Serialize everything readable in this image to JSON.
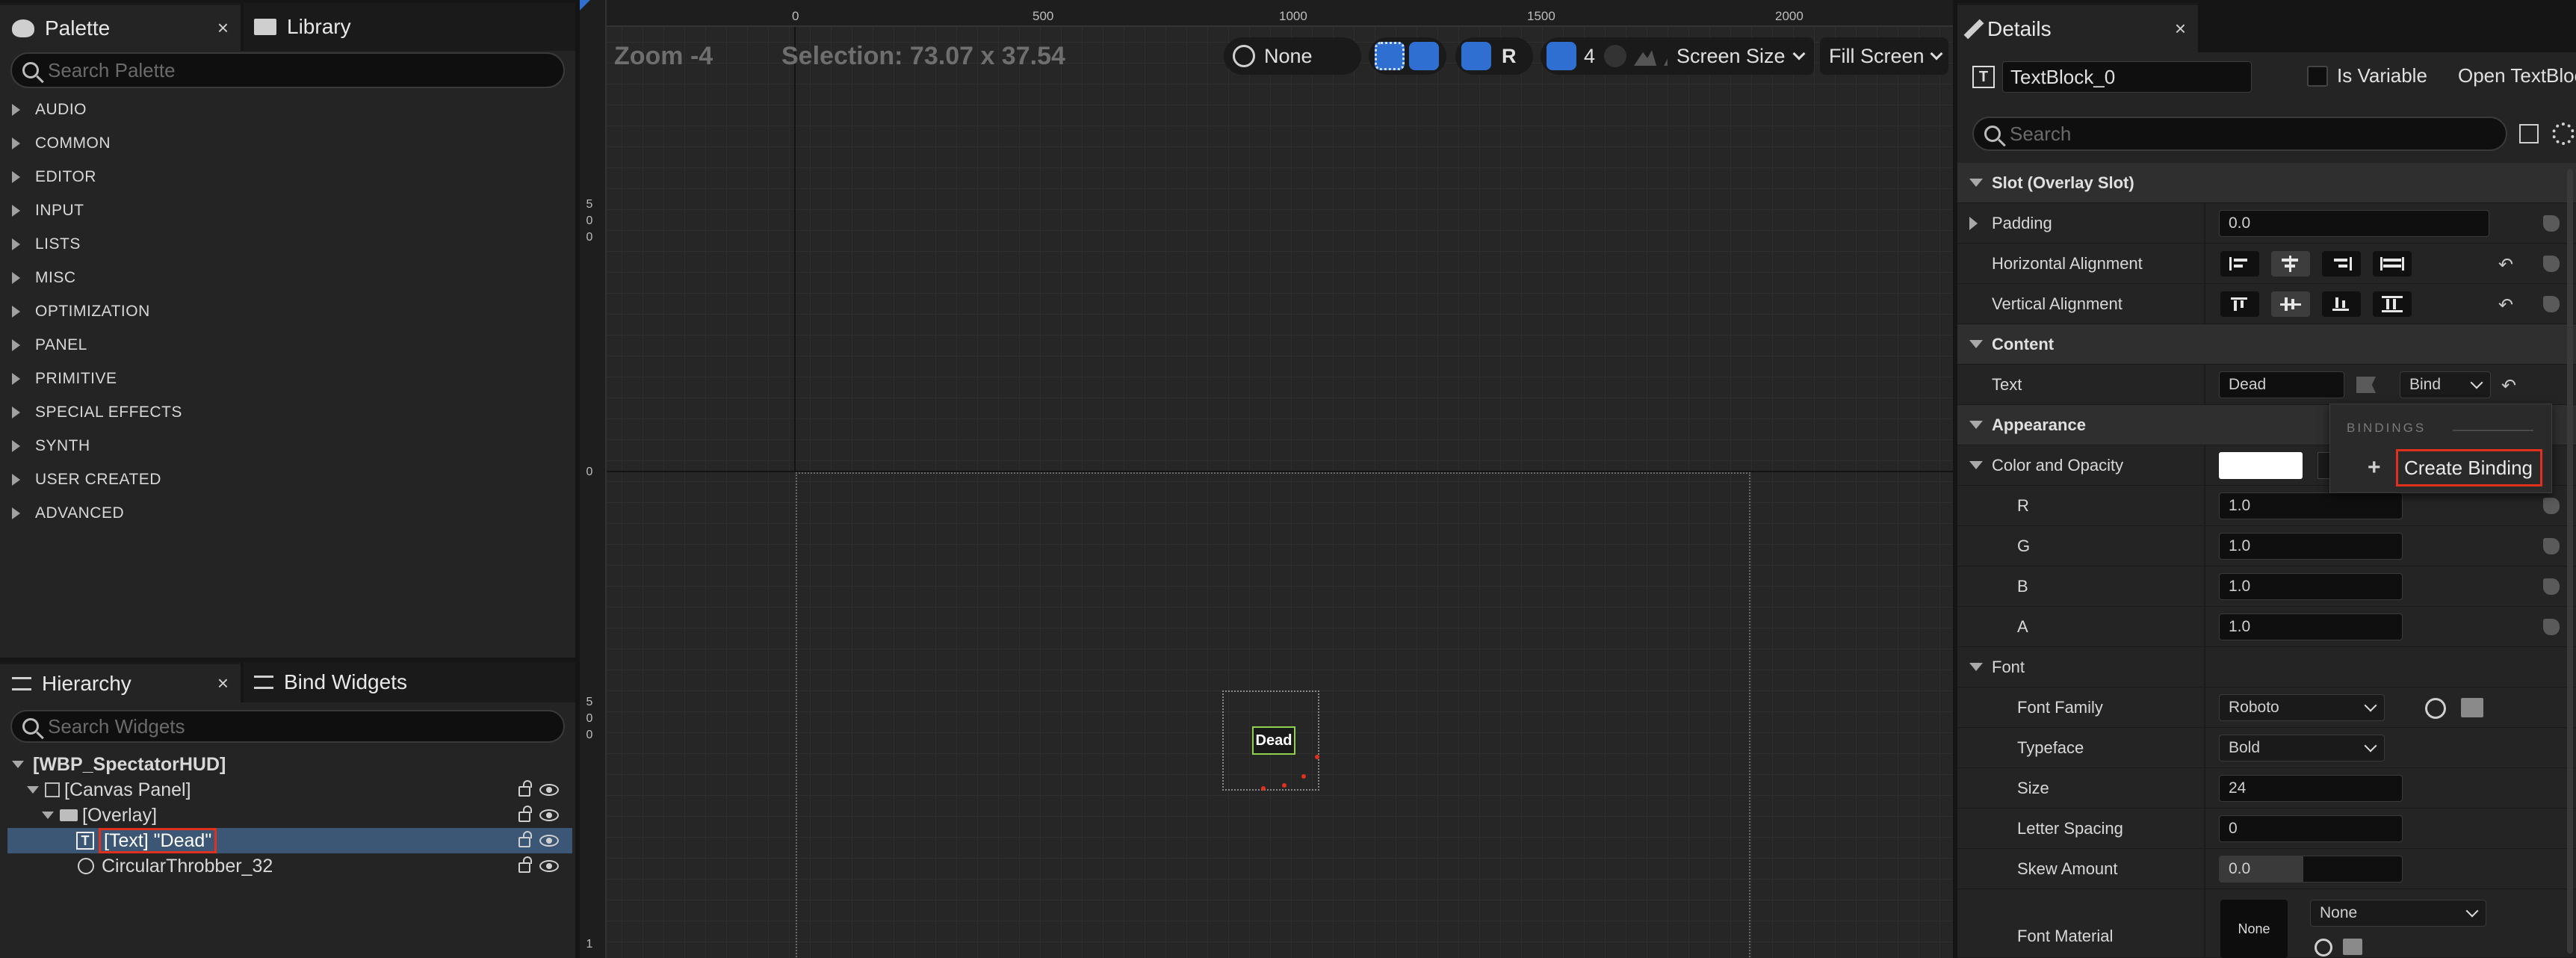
{
  "palette": {
    "tab_label": "Palette",
    "library_tab_label": "Library",
    "close_glyph": "×",
    "search_placeholder": "Search Palette",
    "categories": [
      "AUDIO",
      "COMMON",
      "EDITOR",
      "INPUT",
      "LISTS",
      "MISC",
      "OPTIMIZATION",
      "PANEL",
      "PRIMITIVE",
      "SPECIAL EFFECTS",
      "SYNTH",
      "USER CREATED",
      "ADVANCED"
    ]
  },
  "hierarchy": {
    "tab_label": "Hierarchy",
    "bind_widgets_tab_label": "Bind Widgets",
    "close_glyph": "×",
    "search_placeholder": "Search Widgets",
    "items": [
      {
        "label": "[WBP_SpectatorHUD]"
      },
      {
        "label": "[Canvas Panel]"
      },
      {
        "label": "[Overlay]"
      },
      {
        "label": "[Text] \"Dead\""
      },
      {
        "label": "CircularThrobber_32"
      }
    ]
  },
  "viewport": {
    "zoom": "Zoom -4",
    "selection": "Selection: 73.07 x 37.54",
    "ruler_top": [
      "0",
      "500",
      "1000",
      "1500",
      "2000"
    ],
    "ruler_left_a": [
      "5",
      "0",
      "0"
    ],
    "ruler_left_zero": "0",
    "ruler_left_b": [
      "5",
      "0",
      "0"
    ],
    "ruler_left_c": "1",
    "toolbar": {
      "none_label": "None",
      "r_label": "R",
      "grid_value": "4",
      "screen_size_label": "Screen Size",
      "fill_screen_label": "Fill Screen"
    },
    "widget_text": "Dead"
  },
  "details": {
    "tab_label": "Details",
    "close_glyph": "×",
    "name_value": "TextBlock_0",
    "is_variable_label": "Is Variable",
    "open_textblock_label": "Open TextBloc",
    "search_placeholder": "Search",
    "sections": {
      "slot": "Slot (Overlay Slot)",
      "content": "Content",
      "appearance": "Appearance",
      "font": "Font"
    },
    "rows": {
      "padding_label": "Padding",
      "padding_value": "0.0",
      "h_align_label": "Horizontal Alignment",
      "v_align_label": "Vertical Alignment",
      "text_label": "Text",
      "text_value": "Dead",
      "bind_label": "Bind",
      "color_label": "Color and Opacity",
      "r_label": "R",
      "r_value": "1.0",
      "g_label": "G",
      "g_value": "1.0",
      "b_label": "B",
      "b_value": "1.0",
      "a_label": "A",
      "a_value": "1.0",
      "font_family_label": "Font Family",
      "font_family_value": "Roboto",
      "typeface_label": "Typeface",
      "typeface_value": "Bold",
      "size_label": "Size",
      "size_value": "24",
      "letter_spacing_label": "Letter Spacing",
      "letter_spacing_value": "0",
      "skew_label": "Skew Amount",
      "skew_value": "0.0",
      "font_material_label": "Font Material",
      "font_material_thumb": "None",
      "font_material_value": "None"
    },
    "bindings_popup": {
      "header": "BINDINGS",
      "create_binding": "Create Binding"
    }
  },
  "colors": {
    "accent_blue": "#2f6fd1",
    "selection_row": "#3b5775",
    "highlight_red": "#e0301e",
    "widget_green": "#8fd14f"
  }
}
